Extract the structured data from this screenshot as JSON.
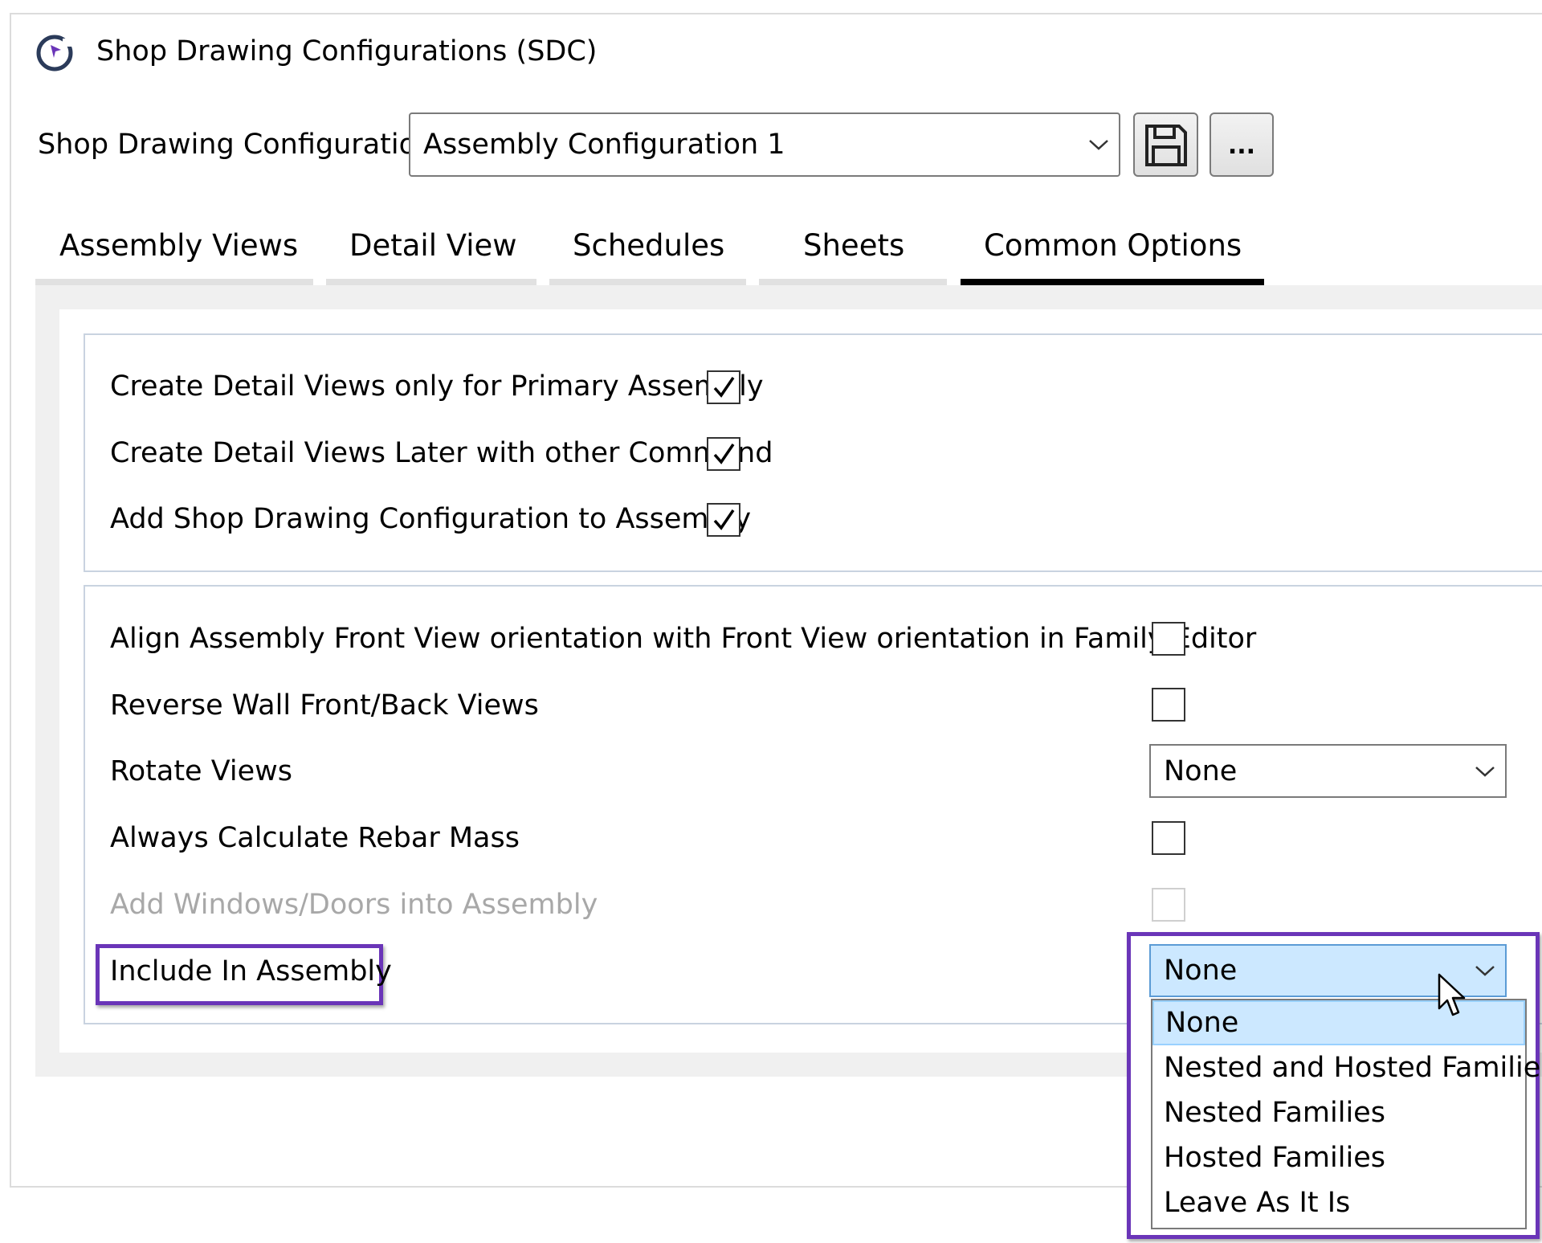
{
  "window": {
    "title": "Shop Drawing Configurations (SDC)",
    "app_icon": "target-arrow-icon"
  },
  "config": {
    "label": "Shop Drawing Configuration",
    "selected": "Assembly Configuration 1",
    "save_icon": "floppy-disk-icon",
    "more_label": "..."
  },
  "tabs": [
    {
      "label": "Assembly Views",
      "active": false
    },
    {
      "label": "Detail View",
      "active": false
    },
    {
      "label": "Schedules",
      "active": false
    },
    {
      "label": "Sheets",
      "active": false
    },
    {
      "label": "Common Options",
      "active": true
    }
  ],
  "group1": [
    {
      "label": "Create Detail Views only for Primary Assembly",
      "checked": true
    },
    {
      "label": "Create Detail Views Later with other Command",
      "checked": true
    },
    {
      "label": "Add Shop Drawing Configuration to Assembly",
      "checked": true
    }
  ],
  "group2": {
    "align_front": {
      "label": "Align Assembly Front View orientation with Front View orientation in Family Editor",
      "checked": false
    },
    "reverse_wall": {
      "label": "Reverse Wall Front/Back Views",
      "checked": false
    },
    "rotate_views": {
      "label": "Rotate Views",
      "value": "None"
    },
    "rebar_mass": {
      "label": "Always Calculate Rebar Mass",
      "checked": false
    },
    "windows_doors": {
      "label": "Add Windows/Doors into Assembly",
      "checked": false,
      "enabled": false
    },
    "include_in_assembly": {
      "label": "Include In Assembly",
      "value": "None",
      "options": [
        "None",
        "Nested and Hosted Families",
        "Nested Families",
        "Hosted Families",
        "Leave As It Is"
      ],
      "highlighted_option": "None"
    }
  },
  "colors": {
    "highlight_frame": "#6a35b8",
    "selection_bg": "#cce8ff",
    "panel_bg": "#f0f0f0"
  }
}
